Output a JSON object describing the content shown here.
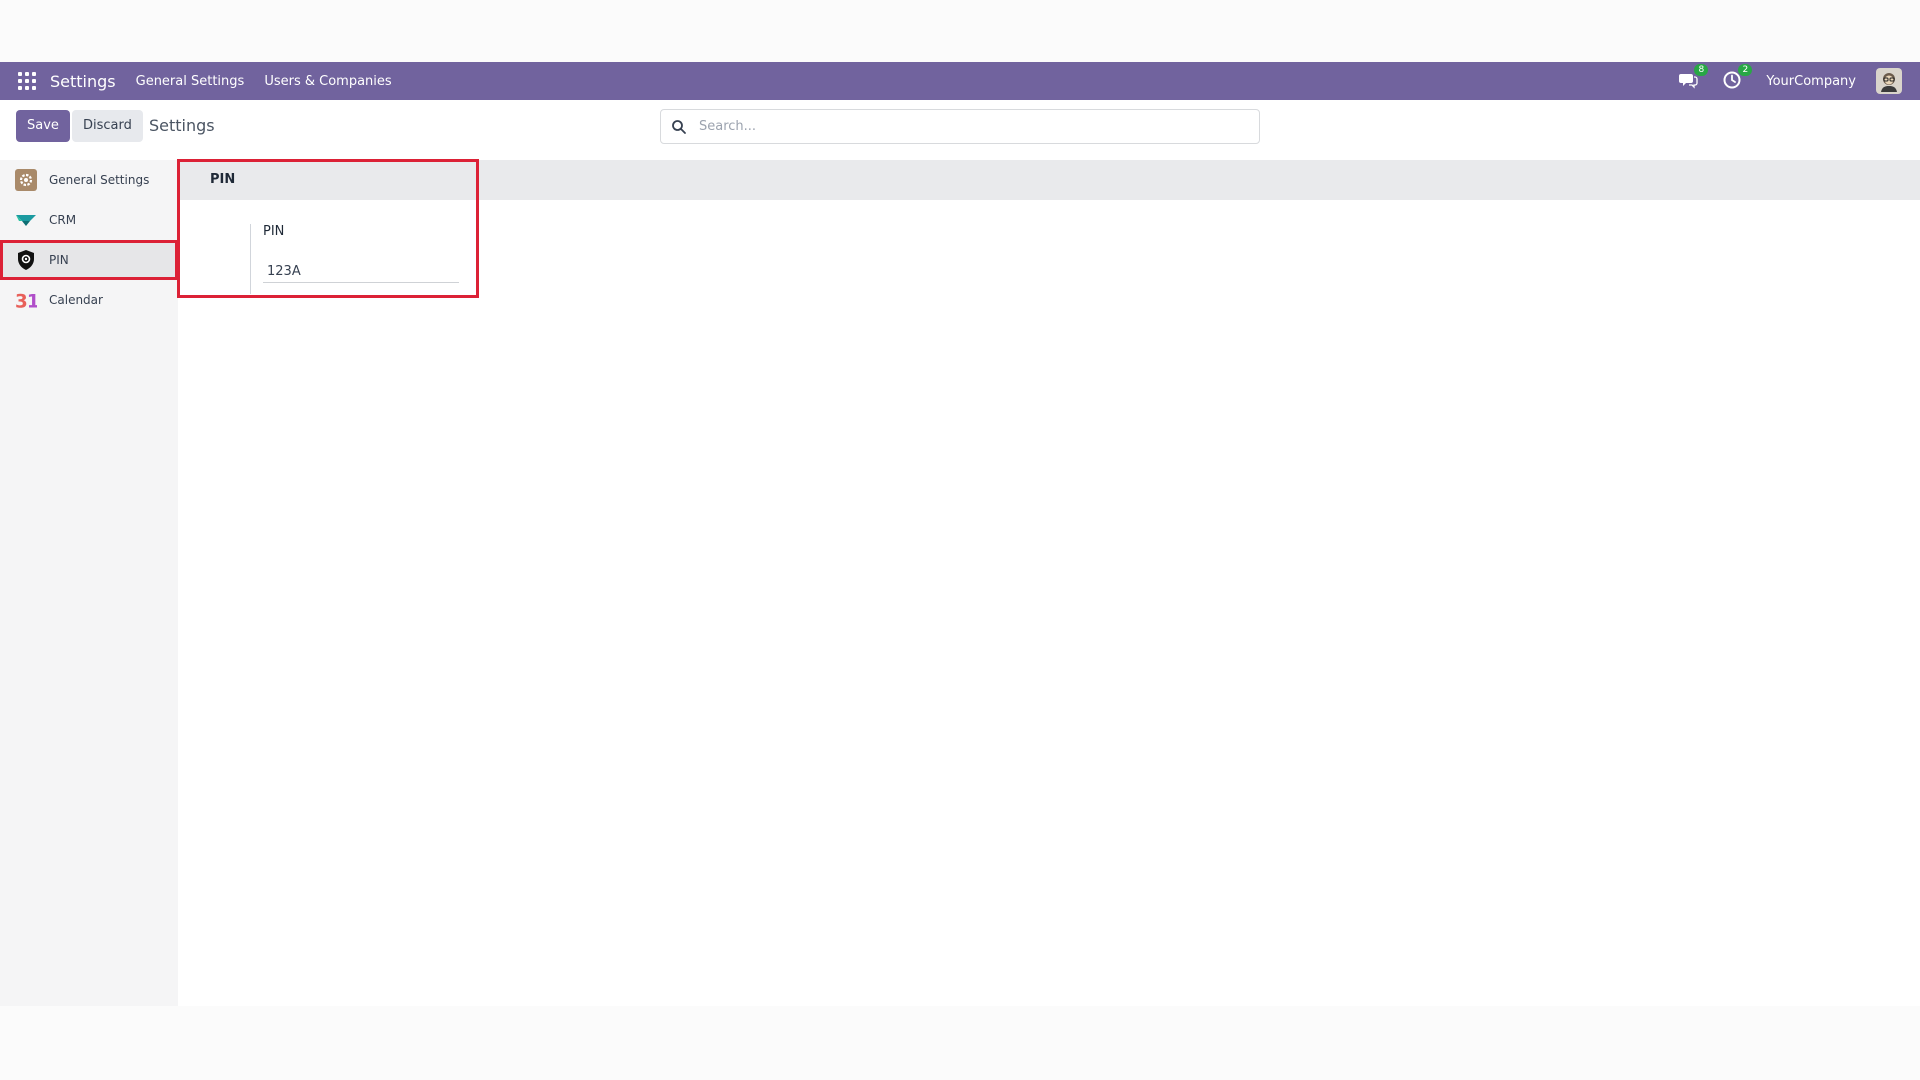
{
  "navbar": {
    "app_name": "Settings",
    "menus": [
      "General Settings",
      "Users & Companies"
    ],
    "messages_badge": "8",
    "activity_badge": "2",
    "company": "YourCompany"
  },
  "control": {
    "save_label": "Save",
    "discard_label": "Discard",
    "breadcrumb": "Settings",
    "search_placeholder": "Search..."
  },
  "sidebar": {
    "items": [
      {
        "label": "General Settings",
        "icon": "gear-icon"
      },
      {
        "label": "CRM",
        "icon": "crm-icon"
      },
      {
        "label": "PIN",
        "icon": "shield-icon",
        "active": true
      },
      {
        "label": "Calendar",
        "icon": "calendar-icon"
      }
    ]
  },
  "main": {
    "section_title": "PIN",
    "field_label": "PIN",
    "field_value": "123A"
  },
  "colors": {
    "brand": "#71639e",
    "highlight": "#dc2136",
    "badge": "#28a745"
  }
}
